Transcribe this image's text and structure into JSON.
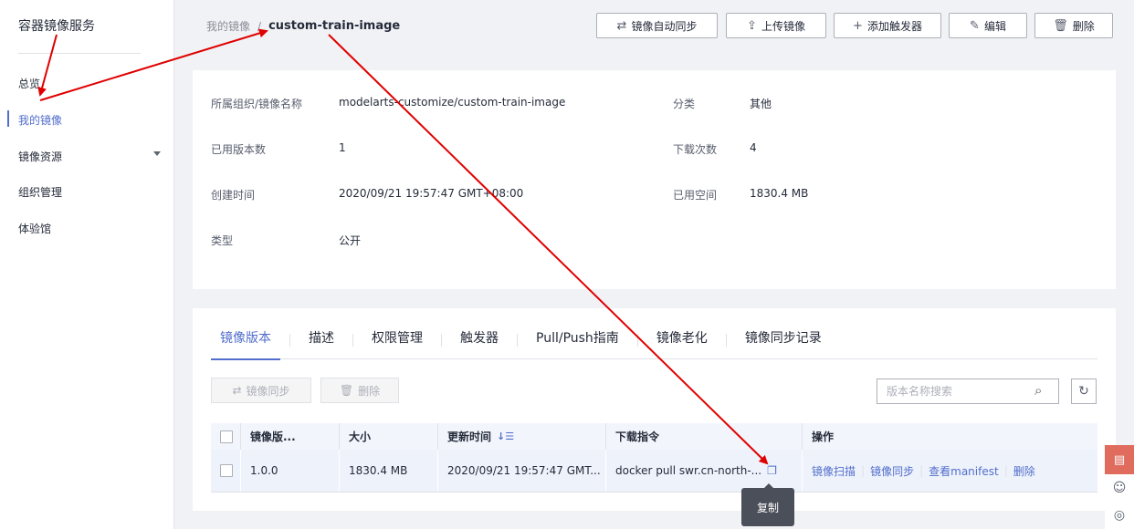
{
  "sidebar": {
    "title": "容器镜像服务",
    "items": [
      {
        "label": "总览"
      },
      {
        "label": "我的镜像"
      },
      {
        "label": "镜像资源"
      },
      {
        "label": "组织管理"
      },
      {
        "label": "体验馆"
      }
    ]
  },
  "breadcrumb": {
    "parent": "我的镜像",
    "separator": "/",
    "current": "custom-train-image"
  },
  "header_buttons": {
    "sync": "镜像自动同步",
    "upload": "上传镜像",
    "add_trigger": "添加触发器",
    "edit": "编辑",
    "delete": "删除"
  },
  "info": {
    "org_image_label": "所属组织/镜像名称",
    "org_image_value": "modelarts-customize/custom-train-image",
    "category_label": "分类",
    "category_value": "其他",
    "versions_label": "已用版本数",
    "versions_value": "1",
    "downloads_label": "下载次数",
    "downloads_value": "4",
    "created_label": "创建时间",
    "created_value": "2020/09/21 19:57:47 GMT+08:00",
    "space_label": "已用空间",
    "space_value": "1830.4 MB",
    "type_label": "类型",
    "type_value": "公开"
  },
  "tabs": [
    {
      "label": "镜像版本"
    },
    {
      "label": "描述"
    },
    {
      "label": "权限管理"
    },
    {
      "label": "触发器"
    },
    {
      "label": "Pull/Push指南"
    },
    {
      "label": "镜像老化"
    },
    {
      "label": "镜像同步记录"
    }
  ],
  "toolbar": {
    "sync": "镜像同步",
    "delete": "删除",
    "search_placeholder": "版本名称搜索"
  },
  "table": {
    "headers": {
      "version": "镜像版...",
      "size": "大小",
      "updated": "更新时间",
      "pull": "下载指令",
      "ops": "操作"
    },
    "rows": [
      {
        "version": "1.0.0",
        "size": "1830.4 MB",
        "updated": "2020/09/21 19:57:47 GMT...",
        "pull": "docker pull swr.cn-north-...",
        "ops": {
          "scan": "镜像扫描",
          "sync": "镜像同步",
          "manifest": "查看manifest",
          "delete": "删除"
        }
      }
    ]
  },
  "tooltip": "复制",
  "colors": {
    "accent": "#526ecc",
    "annotation": "#e00000"
  }
}
